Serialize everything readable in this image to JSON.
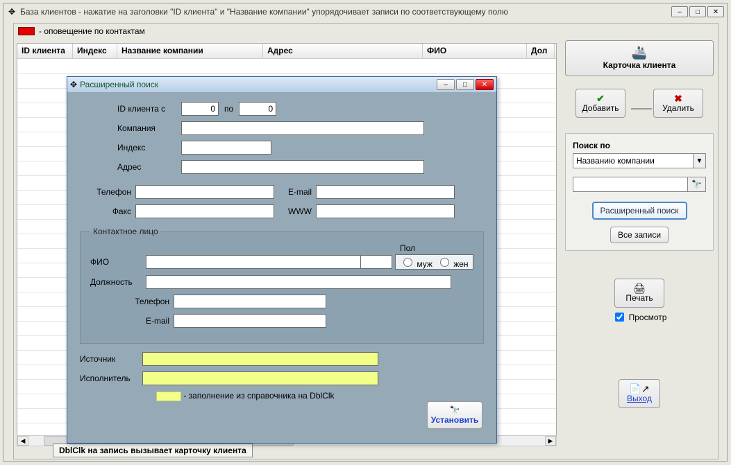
{
  "main": {
    "title": "База клиентов - нажатие на заголовки \"ID клиента\" и \"Название компании\" упорядочивает записи по соответствующему полю",
    "legend": "- оповещение по контактам",
    "hint": "DblClk на запись вызывает карточку клиента"
  },
  "table": {
    "headers": [
      "ID клиента",
      "Индекс",
      "Название компании",
      "Адрес",
      "ФИО",
      "Дол"
    ]
  },
  "side": {
    "card_label": "Карточка клиента",
    "add_label": "Добавить",
    "del_label": "Удалить",
    "search_title": "Поиск по",
    "search_by": "Названию компании",
    "adv_search": "Расширенный поиск",
    "all_records": "Все записи",
    "print_label": "Печать",
    "preview_label": "Просмотр",
    "exit_label": "Выход"
  },
  "dialog": {
    "title": "Расширенный поиск",
    "id_from_label": "ID клиента с",
    "id_from_value": "0",
    "id_to_label": "по",
    "id_to_value": "0",
    "company_label": "Компания",
    "index_label": "Индекс",
    "address_label": "Адрес",
    "phone_label": "Телефон",
    "email_label": "E-mail",
    "fax_label": "Факс",
    "www_label": "WWW",
    "contact_legend": "Контактное лицо",
    "fio_label": "ФИО",
    "sex_label": "Пол",
    "sex_m": "муж",
    "sex_f": "жен",
    "position_label": "Должность",
    "c_phone_label": "Телефон",
    "c_email_label": "E-mail",
    "source_label": "Источник",
    "executor_label": "Исполнитель",
    "yellow_hint": "- заполнение из справочника на DblClk",
    "set_label": "Установить"
  }
}
